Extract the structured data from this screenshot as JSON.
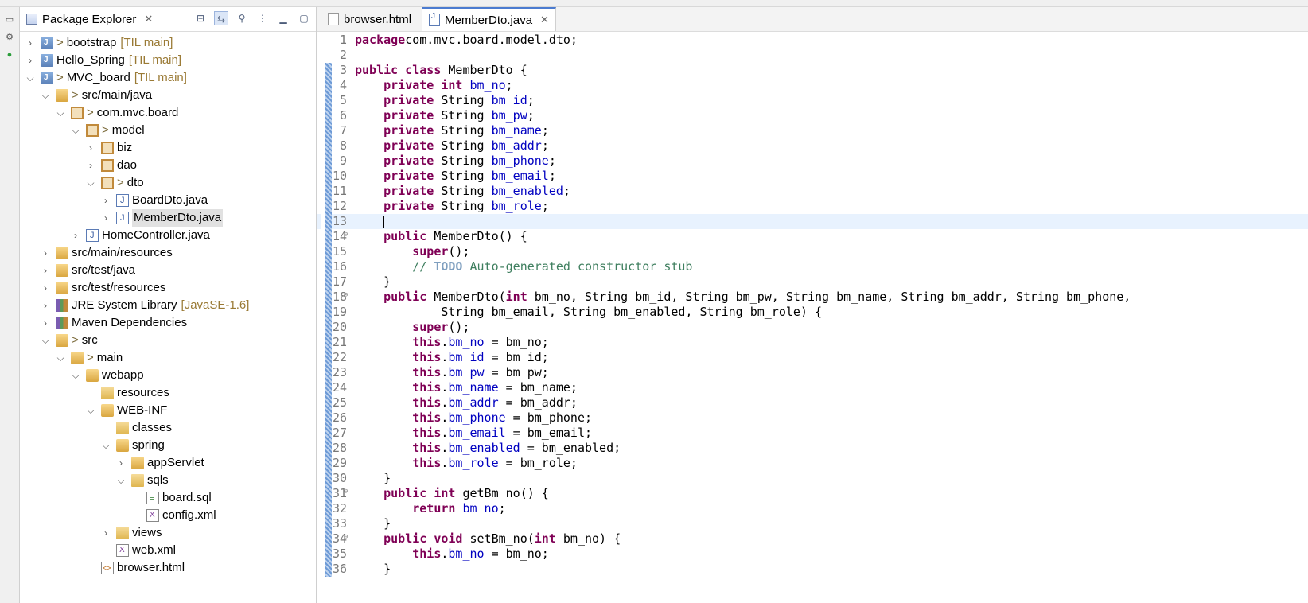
{
  "explorer": {
    "tab_label": "Package Explorer",
    "tree": [
      {
        "depth": 0,
        "twisty": ">",
        "icon": "project",
        "dirty": ">",
        "label": "bootstrap",
        "decor": "[TIL main]"
      },
      {
        "depth": 0,
        "twisty": ">",
        "icon": "project",
        "dirty": "",
        "label": "Hello_Spring",
        "decor": "[TIL main]"
      },
      {
        "depth": 0,
        "twisty": "v",
        "icon": "project",
        "dirty": ">",
        "label": "MVC_board",
        "decor": "[TIL main]"
      },
      {
        "depth": 1,
        "twisty": "v",
        "icon": "srcfolder",
        "dirty": ">",
        "label": "src/main/java",
        "decor": ""
      },
      {
        "depth": 2,
        "twisty": "v",
        "icon": "package",
        "dirty": ">",
        "label": "com.mvc.board",
        "decor": ""
      },
      {
        "depth": 3,
        "twisty": "v",
        "icon": "package",
        "dirty": ">",
        "label": "model",
        "decor": ""
      },
      {
        "depth": 4,
        "twisty": ">",
        "icon": "package",
        "dirty": "",
        "label": "biz",
        "decor": ""
      },
      {
        "depth": 4,
        "twisty": ">",
        "icon": "package",
        "dirty": "",
        "label": "dao",
        "decor": ""
      },
      {
        "depth": 4,
        "twisty": "v",
        "icon": "package",
        "dirty": ">",
        "label": "dto",
        "decor": ""
      },
      {
        "depth": 5,
        "twisty": ">",
        "icon": "java",
        "dirty": "",
        "label": "BoardDto.java",
        "decor": ""
      },
      {
        "depth": 5,
        "twisty": ">",
        "icon": "java",
        "dirty": "",
        "label": "MemberDto.java",
        "decor": "",
        "selected": true
      },
      {
        "depth": 3,
        "twisty": ">",
        "icon": "java",
        "dirty": "",
        "label": "HomeController.java",
        "decor": ""
      },
      {
        "depth": 1,
        "twisty": ">",
        "icon": "srcfolder",
        "dirty": "",
        "label": "src/main/resources",
        "decor": ""
      },
      {
        "depth": 1,
        "twisty": ">",
        "icon": "srcfolder",
        "dirty": "",
        "label": "src/test/java",
        "decor": ""
      },
      {
        "depth": 1,
        "twisty": ">",
        "icon": "srcfolder",
        "dirty": "",
        "label": "src/test/resources",
        "decor": ""
      },
      {
        "depth": 1,
        "twisty": ">",
        "icon": "library",
        "dirty": "",
        "label": "JRE System Library",
        "decor": "[JavaSE-1.6]"
      },
      {
        "depth": 1,
        "twisty": ">",
        "icon": "library",
        "dirty": "",
        "label": "Maven Dependencies",
        "decor": ""
      },
      {
        "depth": 1,
        "twisty": "v",
        "icon": "srcfolder",
        "dirty": ">",
        "label": "src",
        "decor": ""
      },
      {
        "depth": 2,
        "twisty": "v",
        "icon": "srcfolder",
        "dirty": ">",
        "label": "main",
        "decor": ""
      },
      {
        "depth": 3,
        "twisty": "v",
        "icon": "srcfolder",
        "dirty": "",
        "label": "webapp",
        "decor": ""
      },
      {
        "depth": 4,
        "twisty": "",
        "icon": "folder",
        "dirty": "",
        "label": "resources",
        "decor": ""
      },
      {
        "depth": 4,
        "twisty": "v",
        "icon": "srcfolder",
        "dirty": "",
        "label": "WEB-INF",
        "decor": ""
      },
      {
        "depth": 5,
        "twisty": "",
        "icon": "folder",
        "dirty": "",
        "label": "classes",
        "decor": ""
      },
      {
        "depth": 5,
        "twisty": "v",
        "icon": "srcfolder",
        "dirty": "",
        "label": "spring",
        "decor": ""
      },
      {
        "depth": 6,
        "twisty": ">",
        "icon": "srcfolder",
        "dirty": "",
        "label": "appServlet",
        "decor": ""
      },
      {
        "depth": 6,
        "twisty": "v",
        "icon": "folder",
        "dirty": "",
        "label": "sqls",
        "decor": ""
      },
      {
        "depth": 7,
        "twisty": "",
        "icon": "sql",
        "dirty": "",
        "label": "board.sql",
        "decor": ""
      },
      {
        "depth": 7,
        "twisty": "",
        "icon": "xml",
        "dirty": "",
        "label": "config.xml",
        "decor": ""
      },
      {
        "depth": 5,
        "twisty": ">",
        "icon": "folder",
        "dirty": "",
        "label": "views",
        "decor": ""
      },
      {
        "depth": 5,
        "twisty": "",
        "icon": "xml",
        "dirty": "",
        "label": "web.xml",
        "decor": ""
      },
      {
        "depth": 4,
        "twisty": "",
        "icon": "html",
        "dirty": "",
        "label": "browser.html",
        "decor": ""
      }
    ]
  },
  "editor": {
    "tabs": [
      {
        "label": "browser.html",
        "active": false
      },
      {
        "label": "MemberDto.java",
        "active": true
      }
    ],
    "current_line": 13,
    "lines": [
      {
        "n": "1",
        "fold": false,
        "tokens": [
          [
            "kw",
            "package"
          ],
          [
            "",
            "com.mvc.board.model.dto;"
          ]
        ]
      },
      {
        "n": "2",
        "fold": false,
        "tokens": []
      },
      {
        "n": "3",
        "fold": false,
        "tokens": [
          [
            "kw",
            "public class"
          ],
          [
            "",
            " MemberDto {"
          ]
        ]
      },
      {
        "n": "4",
        "fold": false,
        "tokens": [
          [
            "",
            "    "
          ],
          [
            "kw",
            "private int"
          ],
          [
            "",
            " "
          ],
          [
            "fld",
            "bm_no"
          ],
          [
            "",
            ";"
          ]
        ]
      },
      {
        "n": "5",
        "fold": false,
        "tokens": [
          [
            "",
            "    "
          ],
          [
            "kw",
            "private"
          ],
          [
            "",
            " String "
          ],
          [
            "fld",
            "bm_id"
          ],
          [
            "",
            ";"
          ]
        ]
      },
      {
        "n": "6",
        "fold": false,
        "tokens": [
          [
            "",
            "    "
          ],
          [
            "kw",
            "private"
          ],
          [
            "",
            " String "
          ],
          [
            "fld",
            "bm_pw"
          ],
          [
            "",
            ";"
          ]
        ]
      },
      {
        "n": "7",
        "fold": false,
        "tokens": [
          [
            "",
            "    "
          ],
          [
            "kw",
            "private"
          ],
          [
            "",
            " String "
          ],
          [
            "fld",
            "bm_name"
          ],
          [
            "",
            ";"
          ]
        ]
      },
      {
        "n": "8",
        "fold": false,
        "tokens": [
          [
            "",
            "    "
          ],
          [
            "kw",
            "private"
          ],
          [
            "",
            " String "
          ],
          [
            "fld",
            "bm_addr"
          ],
          [
            "",
            ";"
          ]
        ]
      },
      {
        "n": "9",
        "fold": false,
        "tokens": [
          [
            "",
            "    "
          ],
          [
            "kw",
            "private"
          ],
          [
            "",
            " String "
          ],
          [
            "fld",
            "bm_phone"
          ],
          [
            "",
            ";"
          ]
        ]
      },
      {
        "n": "10",
        "fold": false,
        "tokens": [
          [
            "",
            "    "
          ],
          [
            "kw",
            "private"
          ],
          [
            "",
            " String "
          ],
          [
            "fld",
            "bm_email"
          ],
          [
            "",
            ";"
          ]
        ]
      },
      {
        "n": "11",
        "fold": false,
        "tokens": [
          [
            "",
            "    "
          ],
          [
            "kw",
            "private"
          ],
          [
            "",
            " String "
          ],
          [
            "fld",
            "bm_enabled"
          ],
          [
            "",
            ";"
          ]
        ]
      },
      {
        "n": "12",
        "fold": false,
        "tokens": [
          [
            "",
            "    "
          ],
          [
            "kw",
            "private"
          ],
          [
            "",
            " String "
          ],
          [
            "fld",
            "bm_role"
          ],
          [
            "",
            ";"
          ]
        ]
      },
      {
        "n": "13",
        "fold": false,
        "tokens": [
          [
            "",
            "    "
          ],
          [
            "caret",
            ""
          ]
        ]
      },
      {
        "n": "14",
        "fold": true,
        "tokens": [
          [
            "",
            "    "
          ],
          [
            "kw",
            "public"
          ],
          [
            "",
            " MemberDto() {"
          ]
        ]
      },
      {
        "n": "15",
        "fold": false,
        "tokens": [
          [
            "",
            "        "
          ],
          [
            "kw",
            "super"
          ],
          [
            "",
            "();"
          ]
        ]
      },
      {
        "n": "16",
        "fold": false,
        "tokens": [
          [
            "",
            "        "
          ],
          [
            "cmt",
            "// "
          ],
          [
            "todo",
            "TODO"
          ],
          [
            "cmt",
            " Auto-generated constructor stub"
          ]
        ]
      },
      {
        "n": "17",
        "fold": false,
        "tokens": [
          [
            "",
            "    }"
          ]
        ]
      },
      {
        "n": "18",
        "fold": true,
        "tokens": [
          [
            "",
            "    "
          ],
          [
            "kw",
            "public"
          ],
          [
            "",
            " MemberDto("
          ],
          [
            "kw",
            "int"
          ],
          [
            "",
            " bm_no, String bm_id, String bm_pw, String bm_name, String bm_addr, String bm_phone,"
          ]
        ]
      },
      {
        "n": "19",
        "fold": false,
        "tokens": [
          [
            "",
            "            String bm_email, String bm_enabled, String bm_role) {"
          ]
        ]
      },
      {
        "n": "20",
        "fold": false,
        "tokens": [
          [
            "",
            "        "
          ],
          [
            "kw",
            "super"
          ],
          [
            "",
            "();"
          ]
        ]
      },
      {
        "n": "21",
        "fold": false,
        "tokens": [
          [
            "",
            "        "
          ],
          [
            "kw",
            "this"
          ],
          [
            "",
            "."
          ],
          [
            "fld",
            "bm_no"
          ],
          [
            "",
            " = bm_no;"
          ]
        ]
      },
      {
        "n": "22",
        "fold": false,
        "tokens": [
          [
            "",
            "        "
          ],
          [
            "kw",
            "this"
          ],
          [
            "",
            "."
          ],
          [
            "fld",
            "bm_id"
          ],
          [
            "",
            " = bm_id;"
          ]
        ]
      },
      {
        "n": "23",
        "fold": false,
        "tokens": [
          [
            "",
            "        "
          ],
          [
            "kw",
            "this"
          ],
          [
            "",
            "."
          ],
          [
            "fld",
            "bm_pw"
          ],
          [
            "",
            " = bm_pw;"
          ]
        ]
      },
      {
        "n": "24",
        "fold": false,
        "tokens": [
          [
            "",
            "        "
          ],
          [
            "kw",
            "this"
          ],
          [
            "",
            "."
          ],
          [
            "fld",
            "bm_name"
          ],
          [
            "",
            " = bm_name;"
          ]
        ]
      },
      {
        "n": "25",
        "fold": false,
        "tokens": [
          [
            "",
            "        "
          ],
          [
            "kw",
            "this"
          ],
          [
            "",
            "."
          ],
          [
            "fld",
            "bm_addr"
          ],
          [
            "",
            " = bm_addr;"
          ]
        ]
      },
      {
        "n": "26",
        "fold": false,
        "tokens": [
          [
            "",
            "        "
          ],
          [
            "kw",
            "this"
          ],
          [
            "",
            "."
          ],
          [
            "fld",
            "bm_phone"
          ],
          [
            "",
            " = bm_phone;"
          ]
        ]
      },
      {
        "n": "27",
        "fold": false,
        "tokens": [
          [
            "",
            "        "
          ],
          [
            "kw",
            "this"
          ],
          [
            "",
            "."
          ],
          [
            "fld",
            "bm_email"
          ],
          [
            "",
            " = bm_email;"
          ]
        ]
      },
      {
        "n": "28",
        "fold": false,
        "tokens": [
          [
            "",
            "        "
          ],
          [
            "kw",
            "this"
          ],
          [
            "",
            "."
          ],
          [
            "fld",
            "bm_enabled"
          ],
          [
            "",
            " = bm_enabled;"
          ]
        ]
      },
      {
        "n": "29",
        "fold": false,
        "tokens": [
          [
            "",
            "        "
          ],
          [
            "kw",
            "this"
          ],
          [
            "",
            "."
          ],
          [
            "fld",
            "bm_role"
          ],
          [
            "",
            " = bm_role;"
          ]
        ]
      },
      {
        "n": "30",
        "fold": false,
        "tokens": [
          [
            "",
            "    }"
          ]
        ]
      },
      {
        "n": "31",
        "fold": true,
        "tokens": [
          [
            "",
            "    "
          ],
          [
            "kw",
            "public int"
          ],
          [
            "",
            " getBm_no() {"
          ]
        ]
      },
      {
        "n": "32",
        "fold": false,
        "tokens": [
          [
            "",
            "        "
          ],
          [
            "kw",
            "return"
          ],
          [
            "",
            " "
          ],
          [
            "fld",
            "bm_no"
          ],
          [
            "",
            ";"
          ]
        ]
      },
      {
        "n": "33",
        "fold": false,
        "tokens": [
          [
            "",
            "    }"
          ]
        ]
      },
      {
        "n": "34",
        "fold": true,
        "tokens": [
          [
            "",
            "    "
          ],
          [
            "kw",
            "public void"
          ],
          [
            "",
            " setBm_no("
          ],
          [
            "kw",
            "int"
          ],
          [
            "",
            " bm_no) {"
          ]
        ]
      },
      {
        "n": "35",
        "fold": false,
        "tokens": [
          [
            "",
            "        "
          ],
          [
            "kw",
            "this"
          ],
          [
            "",
            "."
          ],
          [
            "fld",
            "bm_no"
          ],
          [
            "",
            " = bm_no;"
          ]
        ]
      },
      {
        "n": "36",
        "fold": false,
        "tokens": [
          [
            "",
            "    }"
          ]
        ]
      }
    ]
  },
  "icons": {
    "trim": [
      "restore-icon",
      "views-icon",
      "server-icon"
    ],
    "explorer_actions": [
      "collapse-all-icon",
      "link-with-editor-icon",
      "filter-icon",
      "view-menu-icon",
      "minimize-icon",
      "maximize-icon"
    ]
  },
  "colors": {
    "keyword": "#7f0055",
    "field": "#0000c0",
    "comment": "#3f7f5f",
    "todo": "#7f9fbf",
    "current_line": "#e8f2fe",
    "selection": "#e1e1e1",
    "decoration": "#9a7a35"
  }
}
